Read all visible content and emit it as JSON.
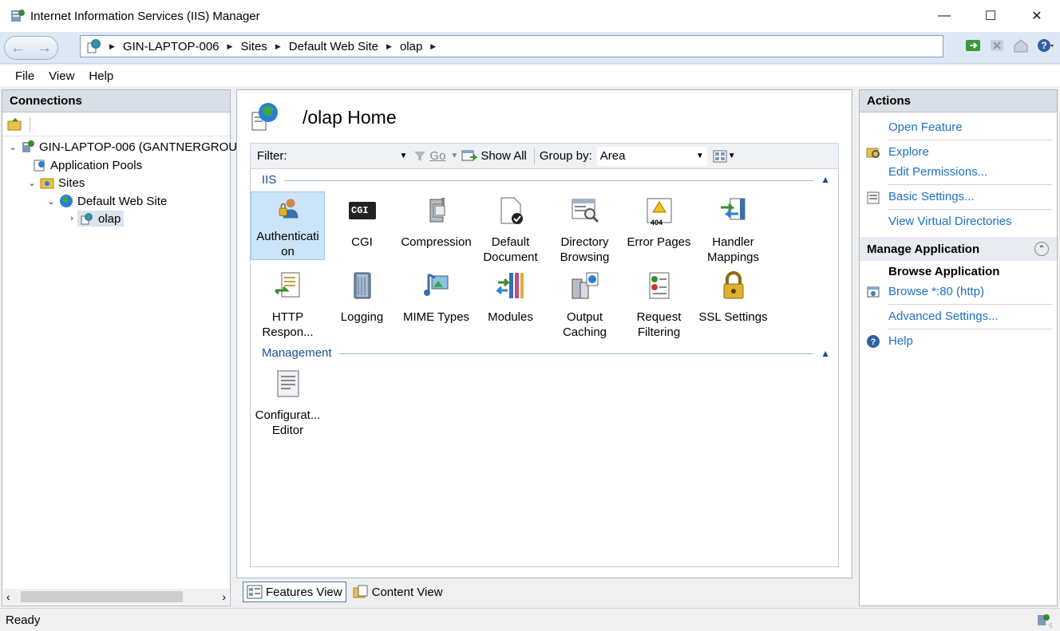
{
  "window": {
    "title": "Internet Information Services (IIS) Manager"
  },
  "address": {
    "breadcrumbs": [
      "GIN-LAPTOP-006",
      "Sites",
      "Default Web Site",
      "olap"
    ]
  },
  "menu": {
    "file": "File",
    "view": "View",
    "help": "Help"
  },
  "connections": {
    "title": "Connections",
    "tree": {
      "server": "GIN-LAPTOP-006 (GANTNERGROU",
      "app_pools": "Application Pools",
      "sites": "Sites",
      "default_site": "Default Web Site",
      "olap": "olap"
    }
  },
  "main": {
    "title": "/olap Home",
    "filter": {
      "label": "Filter:",
      "value": "",
      "go": "Go",
      "show_all": "Show All",
      "group_by_label": "Group by:",
      "group_by_value": "Area"
    },
    "groups": {
      "iis": "IIS",
      "management": "Management"
    },
    "features": {
      "authentication": "Authentication",
      "cgi": "CGI",
      "compression": "Compression",
      "default_document_1": "Default",
      "default_document_2": "Document",
      "directory_browsing_1": "Directory",
      "directory_browsing_2": "Browsing",
      "error_pages": "Error Pages",
      "handler_mappings_1": "Handler",
      "handler_mappings_2": "Mappings",
      "http_response_1": "HTTP",
      "http_response_2": "Respon...",
      "logging": "Logging",
      "mime_types": "MIME Types",
      "modules": "Modules",
      "output_caching_1": "Output",
      "output_caching_2": "Caching",
      "request_filtering_1": "Request",
      "request_filtering_2": "Filtering",
      "ssl_settings": "SSL Settings",
      "config_editor_1": "Configurat...",
      "config_editor_2": "Editor"
    },
    "auth_line1": "Authenticati",
    "auth_line2": "on",
    "cgi_badge": "CGI",
    "error_badge": "404"
  },
  "view_tabs": {
    "features": "Features View",
    "content": "Content View"
  },
  "actions": {
    "title": "Actions",
    "open_feature": "Open Feature",
    "explore": "Explore",
    "edit_permissions": "Edit Permissions...",
    "basic_settings": "Basic Settings...",
    "view_virtual_dirs": "View Virtual Directories",
    "manage_app_head": "Manage Application",
    "browse_app": "Browse Application",
    "browse_80": "Browse *:80 (http)",
    "advanced_settings": "Advanced Settings...",
    "help": "Help"
  },
  "status": {
    "text": "Ready"
  },
  "colors": {
    "link": "#1f6fc4",
    "group": "#1f4e8f",
    "selection": "#cce4f7"
  }
}
